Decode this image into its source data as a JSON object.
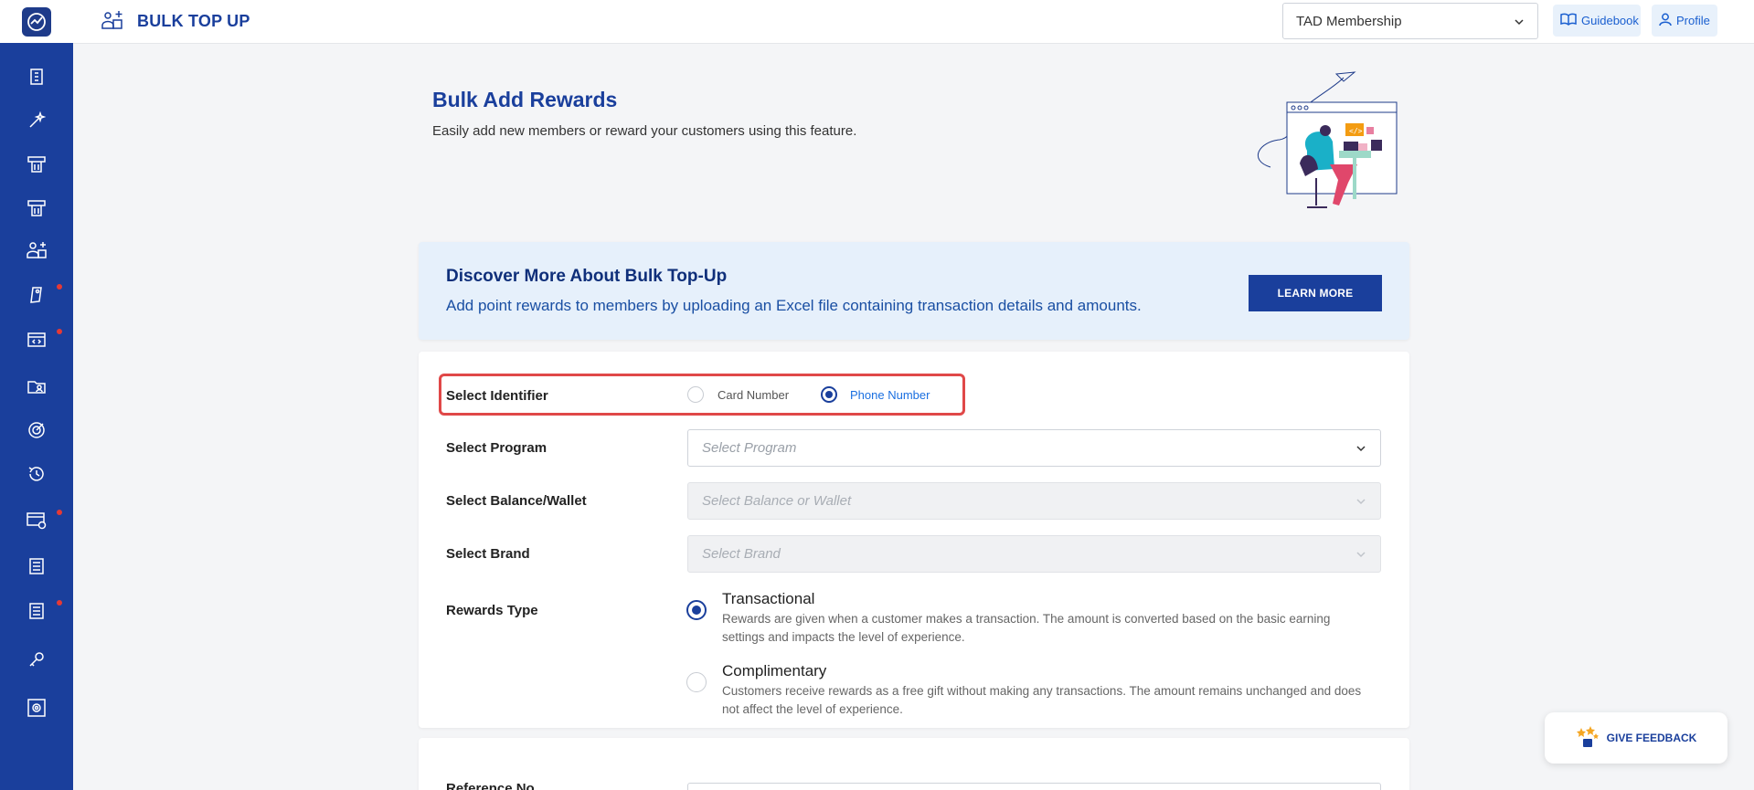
{
  "topbar": {
    "title": "BULK TOP UP",
    "membership_value": "TAD Membership",
    "guidebook_label": "Guidebook",
    "profile_label": "Profile"
  },
  "hero": {
    "title": "Bulk Add Rewards",
    "subtitle": "Easily add new members or reward your customers using this feature."
  },
  "banner": {
    "title": "Discover More About Bulk Top-Up",
    "description": "Add point rewards to members by uploading an Excel file containing transaction details and amounts.",
    "button_label": "LEARN MORE"
  },
  "form": {
    "identifier_label": "Select Identifier",
    "identifier_options": [
      "Card Number",
      "Phone Number"
    ],
    "identifier_selected": "Phone Number",
    "program_label": "Select Program",
    "program_placeholder": "Select Program",
    "wallet_label": "Select Balance/Wallet",
    "wallet_placeholder": "Select Balance or Wallet",
    "brand_label": "Select Brand",
    "brand_placeholder": "Select Brand",
    "rewards_type_label": "Rewards Type",
    "rewards_options": [
      {
        "title": "Transactional",
        "description": "Rewards are given when a customer makes a transaction. The amount is converted based on the basic earning settings and impacts the level of experience.",
        "selected": true
      },
      {
        "title": "Complimentary",
        "description": "Customers receive rewards as a free gift without making any transactions. The amount remains unchanged and does not affect the level of experience.",
        "selected": false
      }
    ],
    "reference_label": "Reference No"
  },
  "feedback_label": "GIVE FEEDBACK",
  "sidebar_icons": [
    "building-icon",
    "magic-wand-icon",
    "voucher-icon",
    "voucher-icon",
    "user-group-icon",
    "tag-icon",
    "code-window-icon",
    "folder-user-icon",
    "target-icon",
    "history-icon",
    "settings-card-icon",
    "receipt-icon",
    "receipt-icon",
    "key-icon",
    "gear-doc-icon"
  ],
  "colors": {
    "brand": "#1a3f9c",
    "accent_light": "#e6f0fb",
    "alert": "#e04848"
  }
}
